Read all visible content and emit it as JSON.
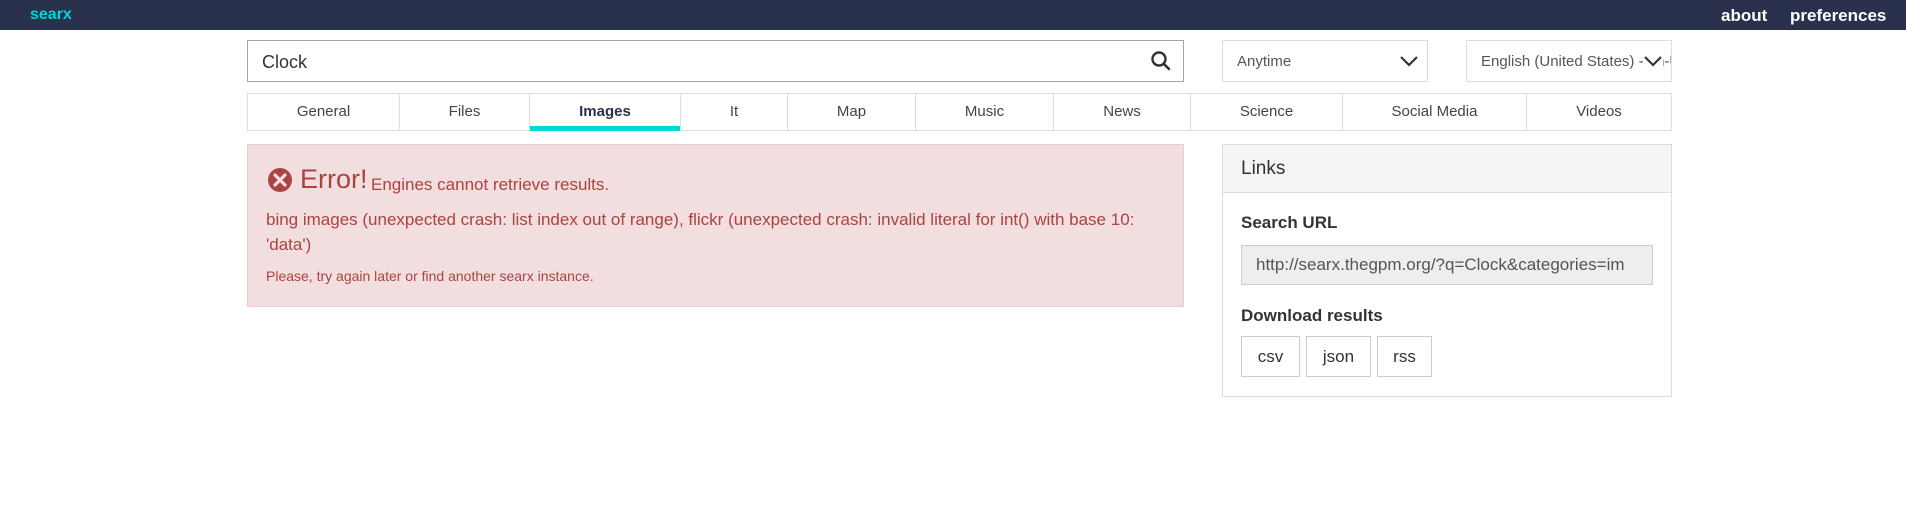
{
  "nav": {
    "brand": "searx",
    "about": "about",
    "preferences": "preferences"
  },
  "search": {
    "query": "Clock",
    "icon": "search-icon"
  },
  "filters": {
    "time_range": "Anytime",
    "language": "English (United States) - en-US"
  },
  "categories": [
    {
      "label": "General",
      "active": false
    },
    {
      "label": "Files",
      "active": false
    },
    {
      "label": "Images",
      "active": true
    },
    {
      "label": "It",
      "active": false
    },
    {
      "label": "Map",
      "active": false
    },
    {
      "label": "Music",
      "active": false
    },
    {
      "label": "News",
      "active": false
    },
    {
      "label": "Science",
      "active": false
    },
    {
      "label": "Social Media",
      "active": false
    },
    {
      "label": "Videos",
      "active": false
    }
  ],
  "error": {
    "title": "Error!",
    "subtitle": "Engines cannot retrieve results.",
    "detail": "bing images (unexpected crash: list index out of range), flickr (unexpected crash: invalid literal for int() with base 10: 'data')",
    "hint": "Please, try again later or find another searx instance."
  },
  "links_panel": {
    "title": "Links",
    "search_url_label": "Search URL",
    "search_url": "http://searx.thegpm.org/?q=Clock&categories=im",
    "download_label": "Download results",
    "downloads": [
      "csv",
      "json",
      "rss"
    ]
  },
  "colors": {
    "topbar": "#29314d",
    "accent": "#01d7d4",
    "error_bg": "#f2dede",
    "error_text": "#a94442"
  }
}
